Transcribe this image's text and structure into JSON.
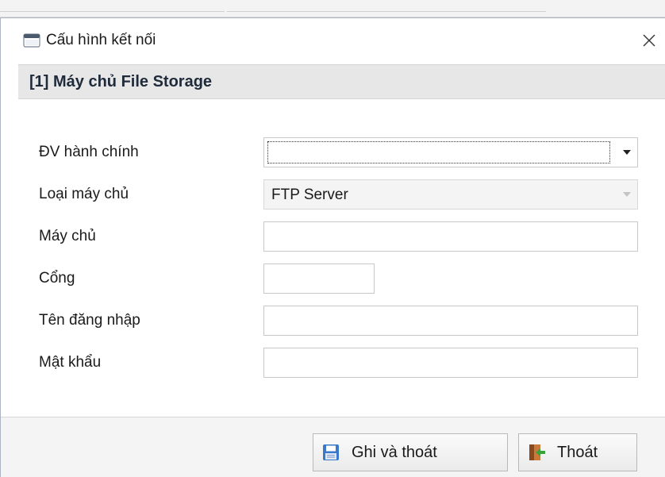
{
  "window": {
    "title": "Cấu hình kết nối",
    "title_icon": "window-icon",
    "close_icon": "close-icon"
  },
  "section": {
    "title": "[1] Máy chủ File Storage"
  },
  "form": {
    "admin_unit": {
      "label": "ĐV hành chính",
      "value": ""
    },
    "server_type": {
      "label": "Loại máy chủ",
      "value": "FTP Server"
    },
    "host": {
      "label": "Máy chủ",
      "value": ""
    },
    "port": {
      "label": "Cổng",
      "value": ""
    },
    "username": {
      "label": "Tên đăng nhập",
      "value": ""
    },
    "password": {
      "label": "Mật khẩu",
      "value": ""
    }
  },
  "buttons": {
    "save_exit": {
      "label": "Ghi và thoát",
      "icon": "floppy-disk-icon"
    },
    "exit": {
      "label": "Thoát",
      "icon": "exit-door-icon"
    }
  },
  "colors": {
    "section_bg": "#e7e7e7",
    "footer_bg": "#f4f4f4",
    "accent_blue": "#3a78c9",
    "exit_green": "#3aa23a"
  }
}
